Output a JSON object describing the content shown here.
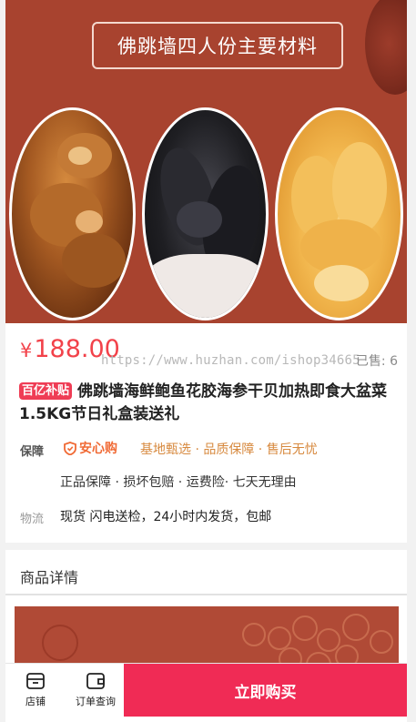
{
  "hero": {
    "banner_title": "佛跳墙四人份主要材料",
    "ingredients": [
      "abalone",
      "sea-cucumber",
      "fish-maw"
    ],
    "colors": {
      "background": "#a8432f",
      "frame": "#ffffff"
    }
  },
  "product": {
    "price_symbol": "¥",
    "price": "188.00",
    "watermark": "https://www.huzhan.com/ishop34665",
    "sold": "已售: 6",
    "badge": "百亿补贴",
    "title": "佛跳墙海鲜鲍鱼花胶海参干贝加热即食大盆菜1.5KG节日礼盒装送礼"
  },
  "guarantee": {
    "label": "保障",
    "brand": "安心购",
    "items": "基地甄选 · 品质保障 · 售后无忧",
    "sub_items": "正品保障 · 损坏包赔 · 运费险· 七天无理由"
  },
  "shipping": {
    "label": "物流",
    "text": "现货 闪电送检，24小时内发货，包邮"
  },
  "details": {
    "title": "商品详情"
  },
  "bottom_bar": {
    "store_label": "店铺",
    "order_label": "订单查询",
    "buy_label": "立即购买"
  },
  "colors": {
    "price": "#f2424a",
    "badge": "#ef3d55",
    "guarantee_brand": "#f06a35",
    "guarantee_items": "#d7893e",
    "buy_button": "#f02b55"
  }
}
